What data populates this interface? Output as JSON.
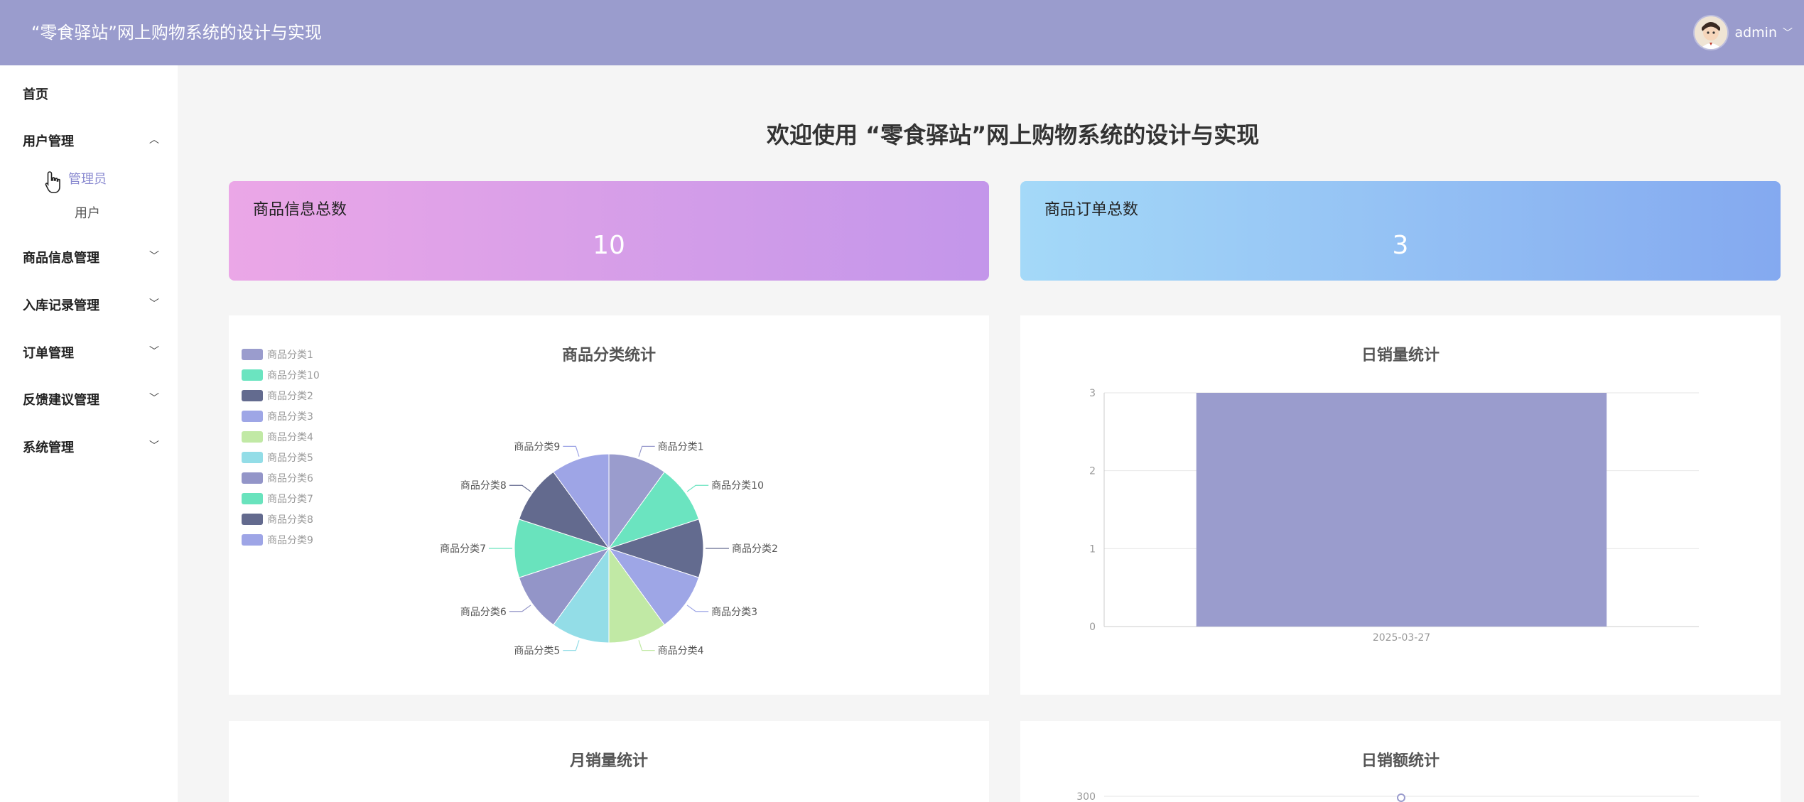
{
  "header": {
    "title": "“零食驿站”网上购物系统的设计与实现",
    "user": "admin"
  },
  "sidebar": {
    "home": "首页",
    "user_mgmt": "用户管理",
    "admin": "管理员",
    "user": "用户",
    "goods_mgmt": "商品信息管理",
    "stock_mgmt": "入库记录管理",
    "order_mgmt": "订单管理",
    "feedback_mgmt": "反馈建议管理",
    "system_mgmt": "系统管理"
  },
  "main": {
    "title": "欢迎使用 “零食驿站”网上购物系统的设计与实现"
  },
  "cards": [
    {
      "label": "商品信息总数",
      "value": "10"
    },
    {
      "label": "商品订单总数",
      "value": "3"
    }
  ],
  "chart_data": [
    {
      "type": "pie",
      "title": "商品分类统计",
      "labels": [
        "商品分类1",
        "商品分类10",
        "商品分类2",
        "商品分类3",
        "商品分类4",
        "商品分类5",
        "商品分类6",
        "商品分类7",
        "商品分类8",
        "商品分类9"
      ],
      "values": [
        1,
        1,
        1,
        1,
        1,
        1,
        1,
        1,
        1,
        1
      ],
      "colors": [
        "#9a9ccd",
        "#6be4c0",
        "#636b8f",
        "#9ea6e6",
        "#c1e9a5",
        "#93dde7",
        "#9395c8",
        "#69e3bd",
        "#636a8e",
        "#9ea5e6"
      ],
      "legend": "left"
    },
    {
      "type": "bar",
      "title": "日销量统计",
      "categories": [
        "2025-03-27"
      ],
      "values": [
        3
      ],
      "ylim": [
        0,
        3
      ],
      "yticks": [
        "0",
        "1",
        "2",
        "3"
      ],
      "color": "#9a9ccd"
    },
    {
      "type": "bar",
      "title": "月销量统计"
    },
    {
      "type": "line",
      "title": "日销额统计",
      "yticks": [
        "300"
      ]
    }
  ]
}
